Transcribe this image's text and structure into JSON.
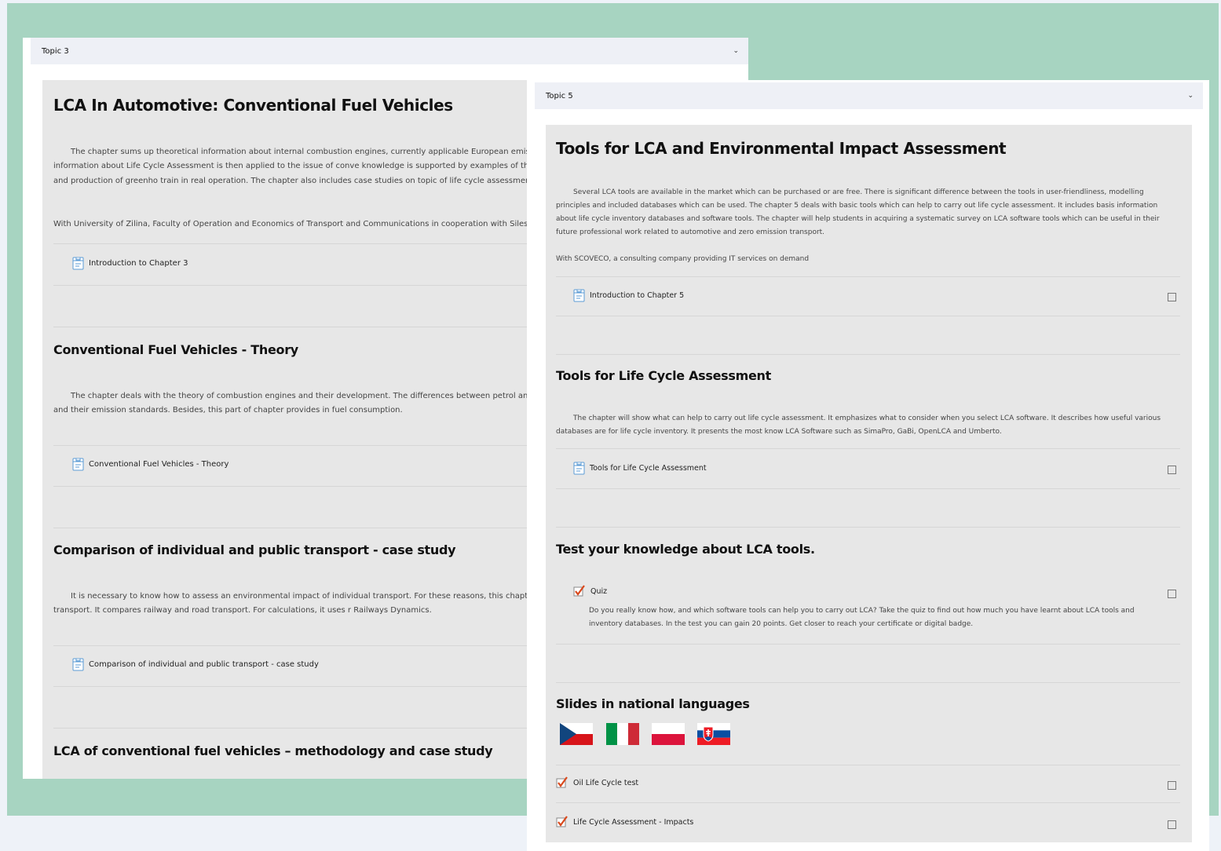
{
  "left": {
    "topic_label": "Topic 3",
    "title": "LCA In Automotive: Conventional Fuel Vehicles",
    "intro_paragraph": "The chapter sums up theoretical information about internal combustion engines, currently applicable European emis consumption measuring. Moreover, general information about Life Cycle Assessment is then applied to the issue of conve knowledge is supported by examples of the results of specific measurements of consumption and production of greenho train in real operation. The chapter also includes case studies on topic of life cycle assessment of conventional fuel vehic",
    "partner_line": "With University of Zilina, Faculty of Operation and Economics of Transport and Communications in cooperation with Silesi",
    "intro_link": "Introduction to Chapter 3",
    "sections": [
      {
        "heading": "Conventional Fuel Vehicles - Theory",
        "paragraph": "The chapter deals with the theory of combustion engines and their development. The differences between petrol an includes the European regulation for road vehicles and their emission standards. Besides, this part of chapter provides in fuel consumption.",
        "link": "Conventional Fuel Vehicles - Theory"
      },
      {
        "heading": "Comparison of individual and public transport - case study",
        "paragraph": "It is necessary to know how to assess an environmental impact of individual transport. For these reasons, this chapt comparative analysis of individual and public transport. It compares railway and road transport. For calculations, it uses r Railways Dynamics.",
        "link": "Comparison of individual and public transport - case study"
      },
      {
        "heading": "LCA of conventional fuel vehicles – methodology and case study"
      }
    ]
  },
  "right": {
    "topic_label": "Topic 5",
    "title": "Tools for LCA and Environmental Impact Assessment",
    "intro_paragraph": "Several LCA tools are available in the market which can be purchased or are free. There is significant difference between the tools in user-friendliness, modelling principles and included databases which can be used. The chapter 5 deals with basic tools which can help to carry out life cycle assessment. It includes basis information about life cycle inventory databases and software tools. The chapter will help students in acquiring a systematic survey on LCA software tools which can be useful in their future professional work related to automotive and zero emission transport.",
    "partner_line": "With SCOVECO, a consulting company providing IT services on demand",
    "intro_link": "Introduction to Chapter 5",
    "tools_heading": "Tools for Life Cycle Assessment",
    "tools_paragraph": "The chapter will show what can help to carry out life cycle assessment. It emphasizes what to consider when you select LCA software. It describes how useful various databases are for life cycle inventory. It presents the most know LCA Software such as SimaPro, GaBi, OpenLCA and Umberto.",
    "tools_link": "Tools for Life Cycle Assessment",
    "test_heading": "Test your knowledge about LCA tools.",
    "quiz_label": "Quiz",
    "quiz_description": "Do you really know how, and which software tools can help you to carry out LCA? Take the quiz to find out how much you have learnt about LCA tools and inventory databases. In the test you can gain 20 points. Get closer to reach your certificate or digital badge.",
    "slides_heading": "Slides in national languages",
    "flags": [
      "czech-flag",
      "italian-flag",
      "polish-flag",
      "slovak-flag"
    ],
    "quiz_items": [
      "Oil Life Cycle test",
      "Life Cycle Assessment - Impacts"
    ]
  }
}
